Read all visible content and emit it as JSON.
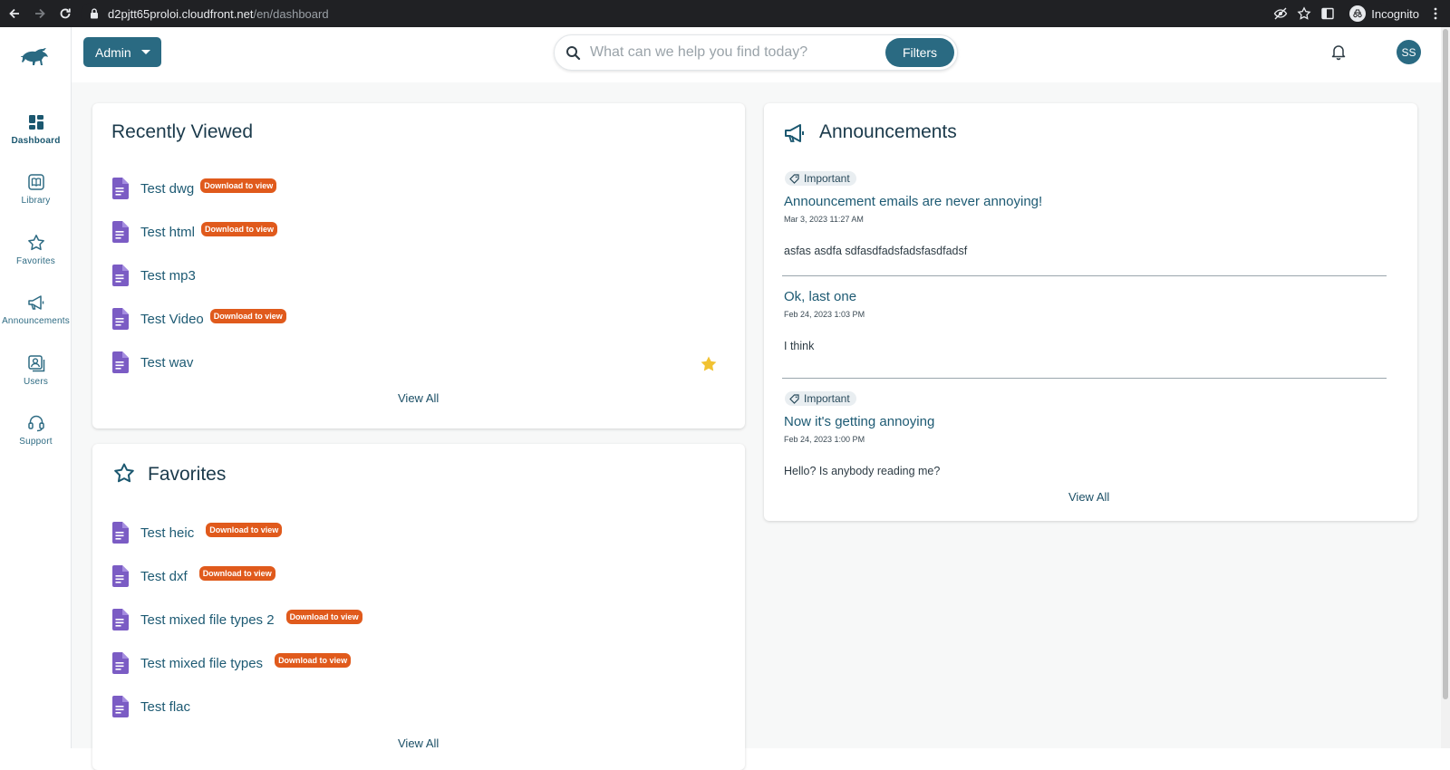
{
  "browser": {
    "url_host": "d2pjtt65proloi.cloudfront.net",
    "url_path": "/en/dashboard",
    "profile_label": "Incognito"
  },
  "header": {
    "admin_label": "Admin",
    "search_placeholder": "What can we help you find today?",
    "filters_label": "Filters",
    "avatar_initials": "SS"
  },
  "sidebar": {
    "items": [
      {
        "label": "Dashboard",
        "icon": "dashboard-icon"
      },
      {
        "label": "Library",
        "icon": "book-icon"
      },
      {
        "label": "Favorites",
        "icon": "star-icon"
      },
      {
        "label": "Announcements",
        "icon": "megaphone-icon"
      },
      {
        "label": "Users",
        "icon": "users-icon"
      },
      {
        "label": "Support",
        "icon": "headset-icon"
      }
    ]
  },
  "recently_viewed": {
    "title": "Recently Viewed",
    "items": [
      {
        "name": "Test dwg",
        "badge": "Download to view"
      },
      {
        "name": "Test html",
        "badge": "Download to view"
      },
      {
        "name": "Test mp3",
        "badge": ""
      },
      {
        "name": "Test Video",
        "badge": "Download to view"
      },
      {
        "name": "Test wav",
        "badge": "",
        "favorited": true
      }
    ],
    "view_all": "View All"
  },
  "favorites": {
    "title": "Favorites",
    "items": [
      {
        "name": "Test heic",
        "badge": "Download to view"
      },
      {
        "name": "Test dxf",
        "badge": "Download to view"
      },
      {
        "name": "Test mixed file types 2",
        "badge": "Download to view"
      },
      {
        "name": "Test mixed file types",
        "badge": "Download to view"
      },
      {
        "name": "Test flac",
        "badge": ""
      }
    ],
    "view_all": "View All"
  },
  "announcements": {
    "title": "Announcements",
    "items": [
      {
        "tag": "Important",
        "title": "Announcement emails are never annoying!",
        "date": "Mar 3, 2023 11:27 AM",
        "body": "asfas asdfa sdfasdfadsfadsfasdfadsf"
      },
      {
        "tag": "",
        "title": "Ok, last one",
        "date": "Feb 24, 2023 1:03 PM",
        "body": "I think"
      },
      {
        "tag": "Important",
        "title": "Now it's getting annoying",
        "date": "Feb 24, 2023 1:00 PM",
        "body": "Hello? Is anybody reading me?"
      }
    ],
    "view_all": "View All"
  },
  "colors": {
    "primary": "#2a6a82",
    "badge": "#e05a1c",
    "file_icon": "#7b5cc4",
    "star": "#f1c232"
  }
}
